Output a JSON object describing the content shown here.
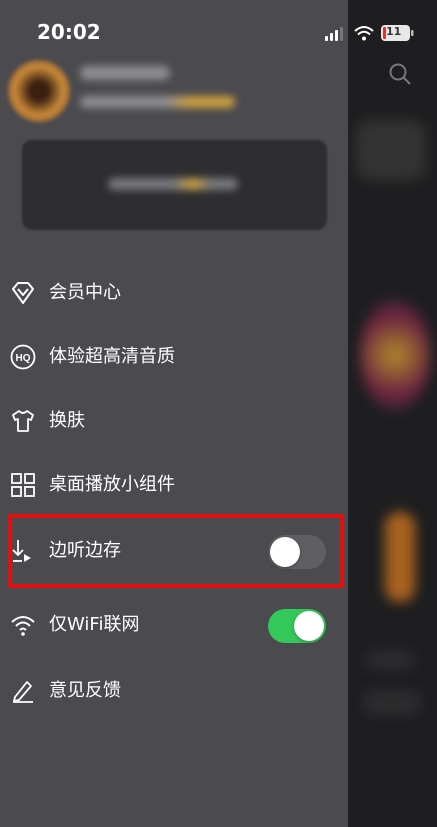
{
  "status_bar": {
    "time": "20:02",
    "battery": "11"
  },
  "profile": {
    "avatar": "avatar-image"
  },
  "menu": {
    "items": [
      {
        "label": "会员中心",
        "icon": "vip-diamond-icon"
      },
      {
        "label": "体验超高清音质",
        "icon": "hq-icon"
      },
      {
        "label": "换肤",
        "icon": "tshirt-icon"
      },
      {
        "label": "桌面播放小组件",
        "icon": "widget-grid-icon"
      },
      {
        "label": "边听边存",
        "icon": "listen-download-icon",
        "toggle": false
      },
      {
        "label": "仅WiFi联网",
        "icon": "wifi-icon",
        "toggle": true
      },
      {
        "label": "意见反馈",
        "icon": "pen-icon"
      }
    ]
  },
  "colors": {
    "drawer_bg": "#4b4a4f",
    "toggle_on": "#34c759",
    "highlight": "#e01010"
  }
}
